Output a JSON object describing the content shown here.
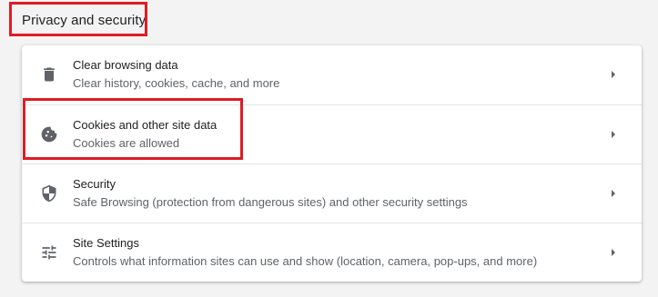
{
  "section": {
    "title": "Privacy and security"
  },
  "items": [
    {
      "title": "Clear browsing data",
      "subtitle": "Clear history, cookies, cache, and more",
      "icon": "trash-icon"
    },
    {
      "title": "Cookies and other site data",
      "subtitle": "Cookies are allowed",
      "icon": "cookie-icon"
    },
    {
      "title": "Security",
      "subtitle": "Safe Browsing (protection from dangerous sites) and other security settings",
      "icon": "shield-icon"
    },
    {
      "title": "Site Settings",
      "subtitle": "Controls what information sites can use and show (location, camera, pop-ups, and more)",
      "icon": "sliders-icon"
    }
  ],
  "colors": {
    "highlight": "#e01b24",
    "icon": "#5f6368",
    "background": "#f3f3f3"
  }
}
